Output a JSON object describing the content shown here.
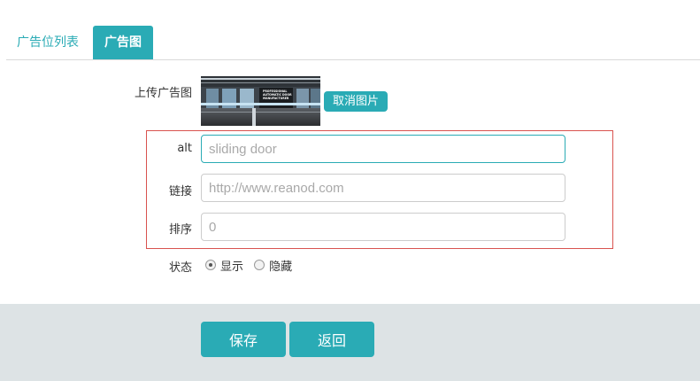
{
  "tabs": {
    "list_label": "广告位列表",
    "active_label": "广告图"
  },
  "upload": {
    "label": "上传广告图",
    "cancel_label": "取消图片",
    "preview_caption_lines": [
      "PROFESSIONAL",
      "AUTOMATIC DOOR",
      "MANUFACTURER"
    ]
  },
  "form": {
    "alt": {
      "label": "alt",
      "placeholder": "sliding door",
      "value": ""
    },
    "link": {
      "label": "链接",
      "placeholder": "http://www.reanod.com",
      "value": ""
    },
    "sort": {
      "label": "排序",
      "placeholder": "0",
      "value": ""
    }
  },
  "status": {
    "label": "状态",
    "options": [
      {
        "label": "显示",
        "checked": true
      },
      {
        "label": "隐藏",
        "checked": false
      }
    ]
  },
  "actions": {
    "save_label": "保存",
    "back_label": "返回"
  },
  "colors": {
    "accent": "#2aabb5",
    "highlight_border": "#d9534f",
    "footer_bg": "#dde3e5"
  }
}
